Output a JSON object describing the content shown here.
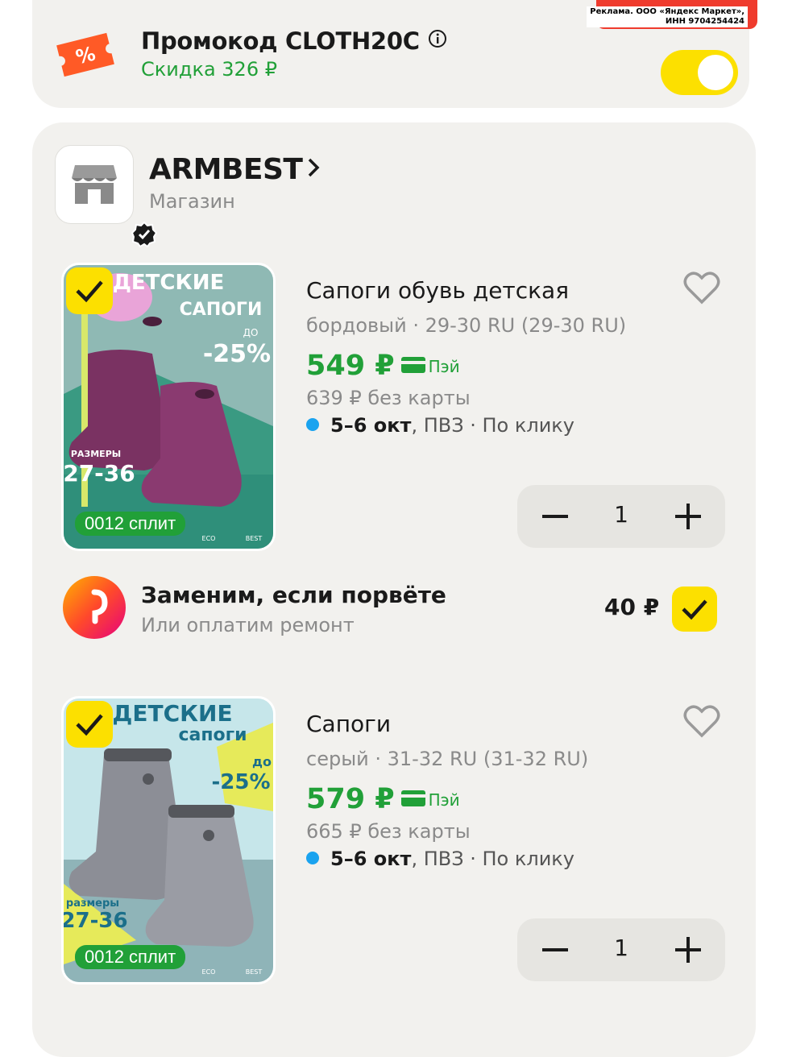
{
  "ad": {
    "line1": "Реклама. ООО «Яндекс Маркет»,",
    "line2": "ИНН 9704254424"
  },
  "promo": {
    "title": "Промокод CLOTH20C",
    "discount": "Скидка 326 ₽",
    "enabled": true,
    "accent_color": "#fce000"
  },
  "shop": {
    "name": "ARMBEST",
    "type": "Магазин"
  },
  "items": [
    {
      "title": "Сапоги  обувь детская",
      "variant": "бордовый · 29-30 RU (29-30 RU)",
      "price": "549 ₽",
      "pay_label": "Пэй",
      "old_price": "639 ₽  без карты",
      "delivery_date": "5–6 окт",
      "delivery_rest": ", ПВЗ · По клику",
      "quantity": "1",
      "split_label": "0012 сплит",
      "image_text": {
        "headline1": "ДЕТСКИЕ",
        "headline2": "САПОГИ",
        "upto": "ДО",
        "discount": "-25%",
        "sizes_label": "РАЗМЕРЫ",
        "sizes": "27-36",
        "eco": "ECO",
        "best": "BEST"
      }
    },
    {
      "title": "Сапоги",
      "variant": "серый · 31-32 RU (31-32 RU)",
      "price": "579 ₽",
      "pay_label": "Пэй",
      "old_price": "665 ₽  без карты",
      "delivery_date": "5–6 окт",
      "delivery_rest": ", ПВЗ · По клику",
      "quantity": "1",
      "split_label": "0012 сплит",
      "image_text": {
        "headline1": "ДЕТСКИЕ",
        "headline2": "сапоги",
        "upto": "до",
        "discount": "-25%",
        "sizes_label": "размеры",
        "sizes": "27-36",
        "eco": "ECO",
        "best": "BEST"
      }
    }
  ],
  "insurance": {
    "title": "Заменим, если порвёте",
    "subtitle": "Или оплатим ремонт",
    "price": "40 ₽",
    "checked": true
  }
}
